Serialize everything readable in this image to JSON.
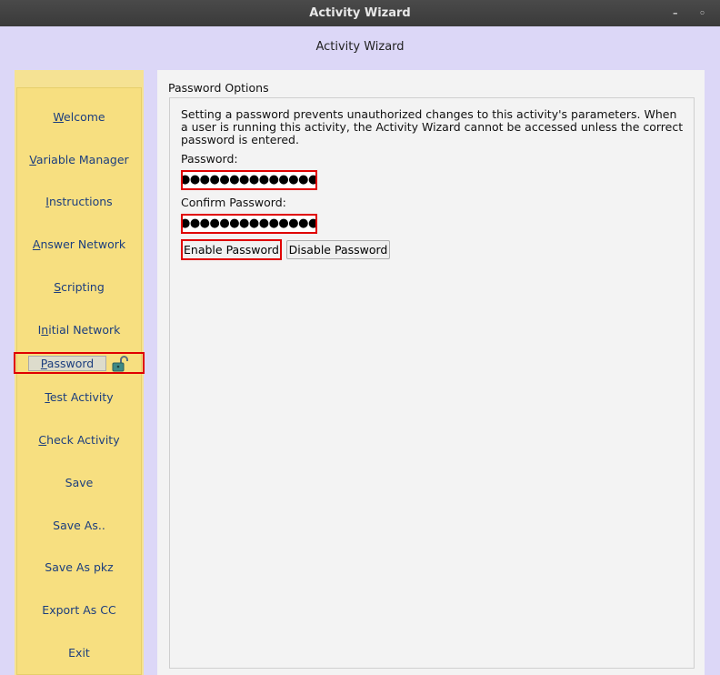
{
  "window": {
    "title": "Activity Wizard",
    "minimize_glyph": "–",
    "restore_glyph": "◦"
  },
  "header": {
    "title": "Activity Wizard"
  },
  "sidebar": {
    "items": [
      {
        "pre": "",
        "mnemonic": "W",
        "post": "elcome"
      },
      {
        "pre": "",
        "mnemonic": "V",
        "post": "ariable Manager"
      },
      {
        "pre": "",
        "mnemonic": "I",
        "post": "nstructions"
      },
      {
        "pre": "",
        "mnemonic": "A",
        "post": "nswer Network"
      },
      {
        "pre": "",
        "mnemonic": "S",
        "post": "cripting"
      },
      {
        "pre": "I",
        "mnemonic": "n",
        "post": "itial Network"
      },
      {
        "pre": "",
        "mnemonic": "P",
        "post": "assword",
        "icon": "unlocked-padlock-icon"
      },
      {
        "pre": "",
        "mnemonic": "T",
        "post": "est Activity"
      },
      {
        "pre": "",
        "mnemonic": "C",
        "post": "heck Activity"
      },
      {
        "pre": "Save",
        "mnemonic": "",
        "post": ""
      },
      {
        "pre": "Save As..",
        "mnemonic": "",
        "post": ""
      },
      {
        "pre": "Save As pkz",
        "mnemonic": "",
        "post": ""
      },
      {
        "pre": "Export As CC",
        "mnemonic": "",
        "post": ""
      },
      {
        "pre": "Exit",
        "mnemonic": "",
        "post": ""
      }
    ]
  },
  "main": {
    "section_title": "Password Options",
    "description": "Setting a password prevents unauthorized changes to this activity's parameters. When a user is running this activity, the Activity Wizard cannot be accessed unless the correct password is entered.",
    "password_label": "Password:",
    "password_value": "●●●●●●●●●●●●●●●",
    "confirm_label": "Confirm Password:",
    "confirm_value": "●●●●●●●●●●●●●●●",
    "enable_button": "Enable Password",
    "disable_button": "Disable Password"
  },
  "colors": {
    "highlight": "#e00000",
    "sidebar": "#f7df80",
    "background": "#dcd7f7",
    "link": "#1c3e7e"
  }
}
